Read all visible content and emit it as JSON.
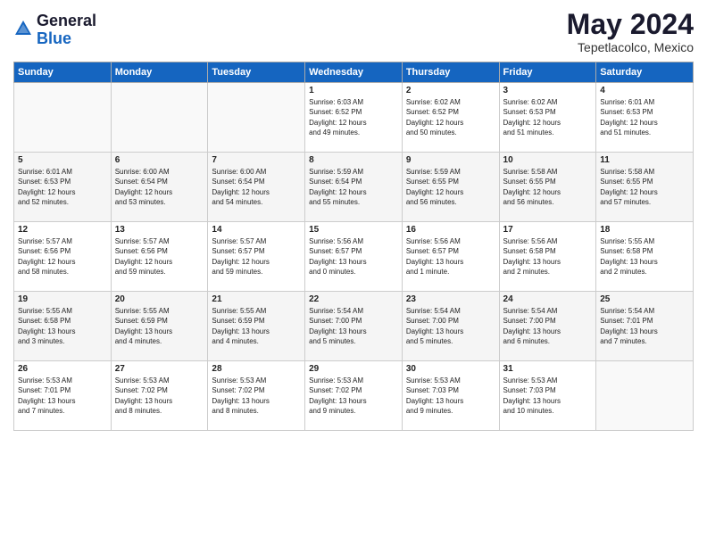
{
  "logo": {
    "general": "General",
    "blue": "Blue"
  },
  "header": {
    "month": "May 2024",
    "location": "Tepetlacolco, Mexico"
  },
  "weekdays": [
    "Sunday",
    "Monday",
    "Tuesday",
    "Wednesday",
    "Thursday",
    "Friday",
    "Saturday"
  ],
  "weeks": [
    [
      {
        "day": "",
        "info": ""
      },
      {
        "day": "",
        "info": ""
      },
      {
        "day": "",
        "info": ""
      },
      {
        "day": "1",
        "info": "Sunrise: 6:03 AM\nSunset: 6:52 PM\nDaylight: 12 hours\nand 49 minutes."
      },
      {
        "day": "2",
        "info": "Sunrise: 6:02 AM\nSunset: 6:52 PM\nDaylight: 12 hours\nand 50 minutes."
      },
      {
        "day": "3",
        "info": "Sunrise: 6:02 AM\nSunset: 6:53 PM\nDaylight: 12 hours\nand 51 minutes."
      },
      {
        "day": "4",
        "info": "Sunrise: 6:01 AM\nSunset: 6:53 PM\nDaylight: 12 hours\nand 51 minutes."
      }
    ],
    [
      {
        "day": "5",
        "info": "Sunrise: 6:01 AM\nSunset: 6:53 PM\nDaylight: 12 hours\nand 52 minutes."
      },
      {
        "day": "6",
        "info": "Sunrise: 6:00 AM\nSunset: 6:54 PM\nDaylight: 12 hours\nand 53 minutes."
      },
      {
        "day": "7",
        "info": "Sunrise: 6:00 AM\nSunset: 6:54 PM\nDaylight: 12 hours\nand 54 minutes."
      },
      {
        "day": "8",
        "info": "Sunrise: 5:59 AM\nSunset: 6:54 PM\nDaylight: 12 hours\nand 55 minutes."
      },
      {
        "day": "9",
        "info": "Sunrise: 5:59 AM\nSunset: 6:55 PM\nDaylight: 12 hours\nand 56 minutes."
      },
      {
        "day": "10",
        "info": "Sunrise: 5:58 AM\nSunset: 6:55 PM\nDaylight: 12 hours\nand 56 minutes."
      },
      {
        "day": "11",
        "info": "Sunrise: 5:58 AM\nSunset: 6:55 PM\nDaylight: 12 hours\nand 57 minutes."
      }
    ],
    [
      {
        "day": "12",
        "info": "Sunrise: 5:57 AM\nSunset: 6:56 PM\nDaylight: 12 hours\nand 58 minutes."
      },
      {
        "day": "13",
        "info": "Sunrise: 5:57 AM\nSunset: 6:56 PM\nDaylight: 12 hours\nand 59 minutes."
      },
      {
        "day": "14",
        "info": "Sunrise: 5:57 AM\nSunset: 6:57 PM\nDaylight: 12 hours\nand 59 minutes."
      },
      {
        "day": "15",
        "info": "Sunrise: 5:56 AM\nSunset: 6:57 PM\nDaylight: 13 hours\nand 0 minutes."
      },
      {
        "day": "16",
        "info": "Sunrise: 5:56 AM\nSunset: 6:57 PM\nDaylight: 13 hours\nand 1 minute."
      },
      {
        "day": "17",
        "info": "Sunrise: 5:56 AM\nSunset: 6:58 PM\nDaylight: 13 hours\nand 2 minutes."
      },
      {
        "day": "18",
        "info": "Sunrise: 5:55 AM\nSunset: 6:58 PM\nDaylight: 13 hours\nand 2 minutes."
      }
    ],
    [
      {
        "day": "19",
        "info": "Sunrise: 5:55 AM\nSunset: 6:58 PM\nDaylight: 13 hours\nand 3 minutes."
      },
      {
        "day": "20",
        "info": "Sunrise: 5:55 AM\nSunset: 6:59 PM\nDaylight: 13 hours\nand 4 minutes."
      },
      {
        "day": "21",
        "info": "Sunrise: 5:55 AM\nSunset: 6:59 PM\nDaylight: 13 hours\nand 4 minutes."
      },
      {
        "day": "22",
        "info": "Sunrise: 5:54 AM\nSunset: 7:00 PM\nDaylight: 13 hours\nand 5 minutes."
      },
      {
        "day": "23",
        "info": "Sunrise: 5:54 AM\nSunset: 7:00 PM\nDaylight: 13 hours\nand 5 minutes."
      },
      {
        "day": "24",
        "info": "Sunrise: 5:54 AM\nSunset: 7:00 PM\nDaylight: 13 hours\nand 6 minutes."
      },
      {
        "day": "25",
        "info": "Sunrise: 5:54 AM\nSunset: 7:01 PM\nDaylight: 13 hours\nand 7 minutes."
      }
    ],
    [
      {
        "day": "26",
        "info": "Sunrise: 5:53 AM\nSunset: 7:01 PM\nDaylight: 13 hours\nand 7 minutes."
      },
      {
        "day": "27",
        "info": "Sunrise: 5:53 AM\nSunset: 7:02 PM\nDaylight: 13 hours\nand 8 minutes."
      },
      {
        "day": "28",
        "info": "Sunrise: 5:53 AM\nSunset: 7:02 PM\nDaylight: 13 hours\nand 8 minutes."
      },
      {
        "day": "29",
        "info": "Sunrise: 5:53 AM\nSunset: 7:02 PM\nDaylight: 13 hours\nand 9 minutes."
      },
      {
        "day": "30",
        "info": "Sunrise: 5:53 AM\nSunset: 7:03 PM\nDaylight: 13 hours\nand 9 minutes."
      },
      {
        "day": "31",
        "info": "Sunrise: 5:53 AM\nSunset: 7:03 PM\nDaylight: 13 hours\nand 10 minutes."
      },
      {
        "day": "",
        "info": ""
      }
    ]
  ]
}
